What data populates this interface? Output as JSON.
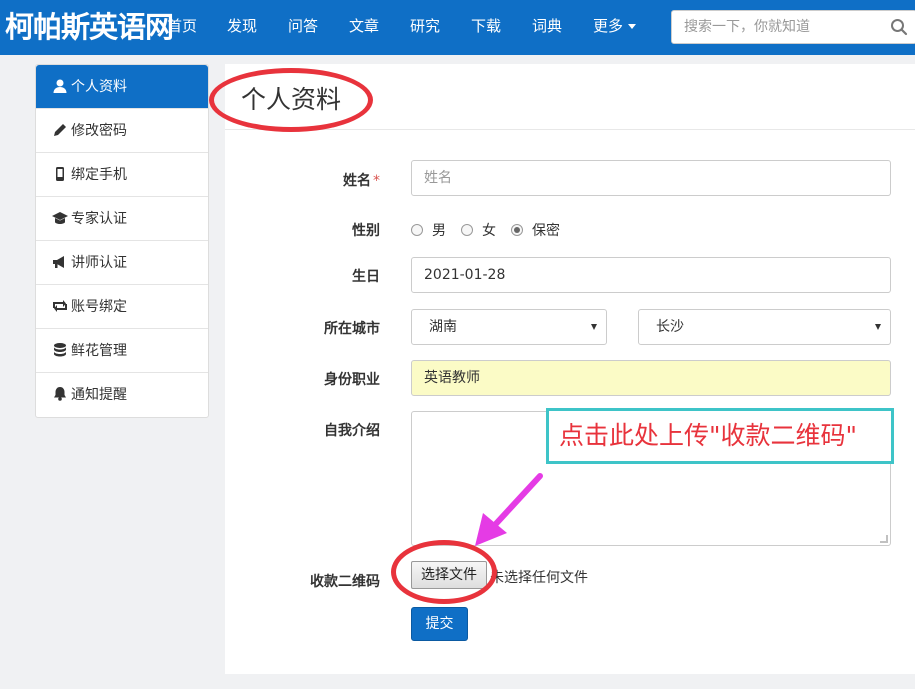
{
  "site": {
    "logo": "柯帕斯英语网"
  },
  "nav": [
    {
      "label": "首页"
    },
    {
      "label": "发现"
    },
    {
      "label": "问答"
    },
    {
      "label": "文章"
    },
    {
      "label": "研究"
    },
    {
      "label": "下载"
    },
    {
      "label": "词典"
    },
    {
      "label": "更多"
    }
  ],
  "search": {
    "placeholder": "搜索一下，你就知道",
    "icon": "search-icon"
  },
  "sidebar": {
    "items": [
      {
        "label": "个人资料",
        "icon": "user-icon",
        "active": true
      },
      {
        "label": "修改密码",
        "icon": "pencil-icon"
      },
      {
        "label": "绑定手机",
        "icon": "mobile-icon"
      },
      {
        "label": "专家认证",
        "icon": "graduation-cap-icon"
      },
      {
        "label": "讲师认证",
        "icon": "bullhorn-icon"
      },
      {
        "label": "账号绑定",
        "icon": "retweet-icon"
      },
      {
        "label": "鲜花管理",
        "icon": "database-icon"
      },
      {
        "label": "通知提醒",
        "icon": "bell-icon"
      }
    ]
  },
  "page": {
    "title": "个人资料"
  },
  "form": {
    "name": {
      "label": "姓名",
      "required_mark": "*",
      "placeholder": "姓名"
    },
    "gender": {
      "label": "性别",
      "options": [
        "男",
        "女",
        "保密"
      ],
      "selected": "保密"
    },
    "birthday": {
      "label": "生日",
      "value": "2021-01-28"
    },
    "city": {
      "label": "所在城市",
      "province": "湖南",
      "city": "长沙"
    },
    "occupation": {
      "label": "身份职业",
      "value": "英语教师"
    },
    "intro": {
      "label": "自我介绍",
      "value": ""
    },
    "qrcode": {
      "label": "收款二维码",
      "button": "选择文件",
      "status": "未选择任何文件"
    },
    "submit": "提交"
  },
  "annotation": {
    "callout": "点击此处上传\"收款二维码\""
  },
  "colors": {
    "brand": "#0f6fc6",
    "annotation_red": "#e8333c",
    "callout_border": "#3ec4c8",
    "arrow": "#e53be5",
    "highlight_input": "#fbfbc6"
  }
}
